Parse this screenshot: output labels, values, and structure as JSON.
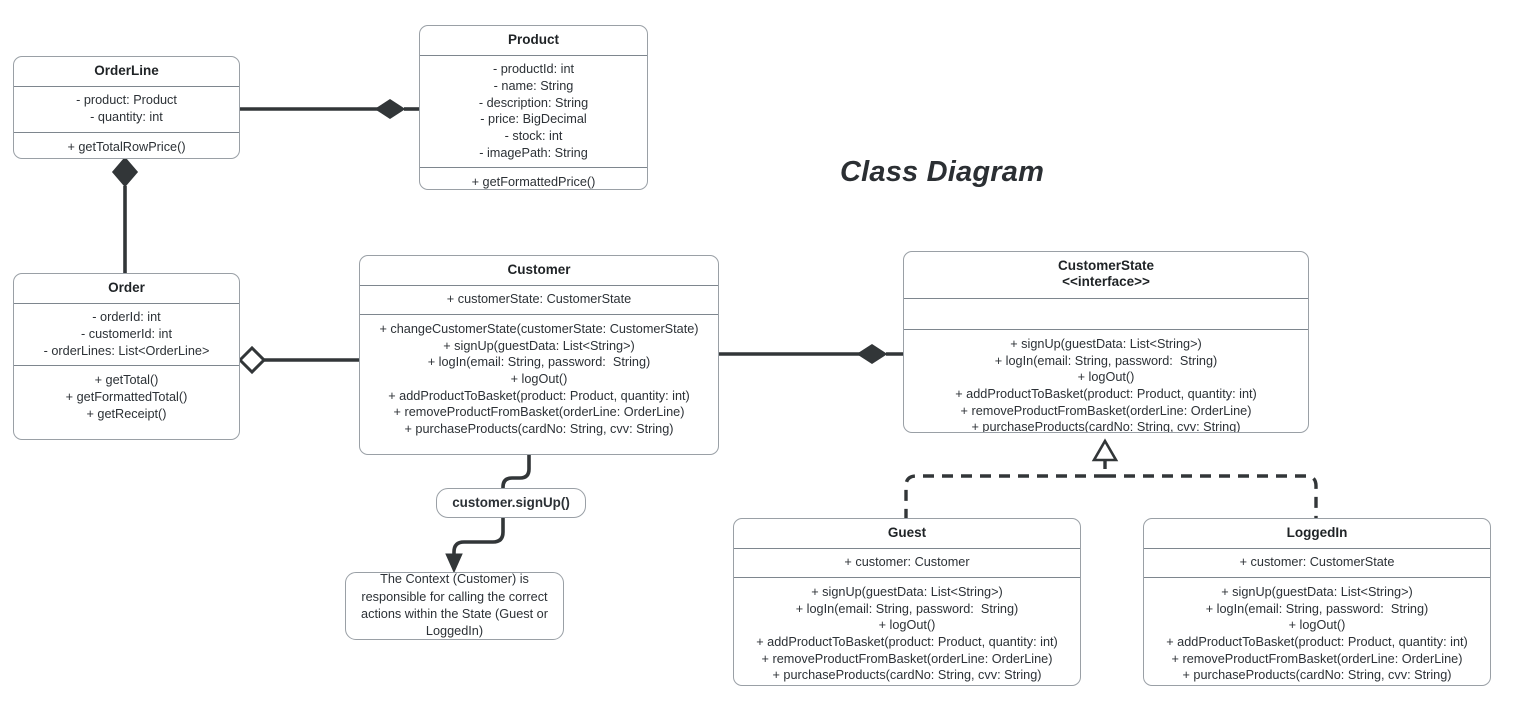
{
  "title": "Class Diagram",
  "classes": {
    "orderline": {
      "name": "OrderLine",
      "attributes": [
        "- product: Product",
        "- quantity: int"
      ],
      "operations": [
        "+ getTotalRowPrice()"
      ]
    },
    "product": {
      "name": "Product",
      "attributes": [
        "- productId: int",
        "- name: String",
        "- description: String",
        "- price: BigDecimal",
        "- stock: int",
        "- imagePath: String"
      ],
      "operations": [
        "+ getFormattedPrice()"
      ]
    },
    "order": {
      "name": "Order",
      "attributes": [
        "- orderId: int",
        "- customerId: int",
        "- orderLines: List<OrderLine>"
      ],
      "operations": [
        "+ getTotal()",
        "+ getFormattedTotal()",
        "+ getReceipt()"
      ]
    },
    "customer": {
      "name": "Customer",
      "attributes": [
        "+ customerState: CustomerState"
      ],
      "operations": [
        "+ changeCustomerState(customerState: CustomerState)",
        "+ signUp(guestData: List<String>)",
        "+ logIn(email: String, password:  String)",
        "+ logOut()",
        "+ addProductToBasket(product: Product, quantity: int)",
        "+ removeProductFromBasket(orderLine: OrderLine)",
        "+ purchaseProducts(cardNo: String, cvv: String)"
      ]
    },
    "customerstate": {
      "name": "CustomerState",
      "stereotype": "<<interface>>",
      "attributes": [],
      "operations": [
        "+ signUp(guestData: List<String>)",
        "+ logIn(email: String, password:  String)",
        "+ logOut()",
        "+ addProductToBasket(product: Product, quantity: int)",
        "+ removeProductFromBasket(orderLine: OrderLine)",
        "+ purchaseProducts(cardNo: String, cvv: String)"
      ]
    },
    "guest": {
      "name": "Guest",
      "attributes": [
        "+ customer: Customer"
      ],
      "operations": [
        "+ signUp(guestData: List<String>)",
        "+ logIn(email: String, password:  String)",
        "+ logOut()",
        "+ addProductToBasket(product: Product, quantity: int)",
        "+ removeProductFromBasket(orderLine: OrderLine)",
        "+ purchaseProducts(cardNo: String, cvv: String)"
      ]
    },
    "loggedin": {
      "name": "LoggedIn",
      "attributes": [
        "+ customer: CustomerState"
      ],
      "operations": [
        "+ signUp(guestData: List<String>)",
        "+ logIn(email: String, password:  String)",
        "+ logOut()",
        "+ addProductToBasket(product: Product, quantity: int)",
        "+ removeProductFromBasket(orderLine: OrderLine)",
        "+ purchaseProducts(cardNo: String, cvv: String)"
      ]
    }
  },
  "annotations": {
    "call_label": "customer.signUp()",
    "note": "The Context (Customer) is responsible for calling the correct actions within the State (Guest or LoggedIn)"
  },
  "colors": {
    "stroke": "#9aa0a6",
    "separator": "#7e868e",
    "connector": "#323638",
    "text": "#2c3136",
    "background": "#ffffff"
  }
}
